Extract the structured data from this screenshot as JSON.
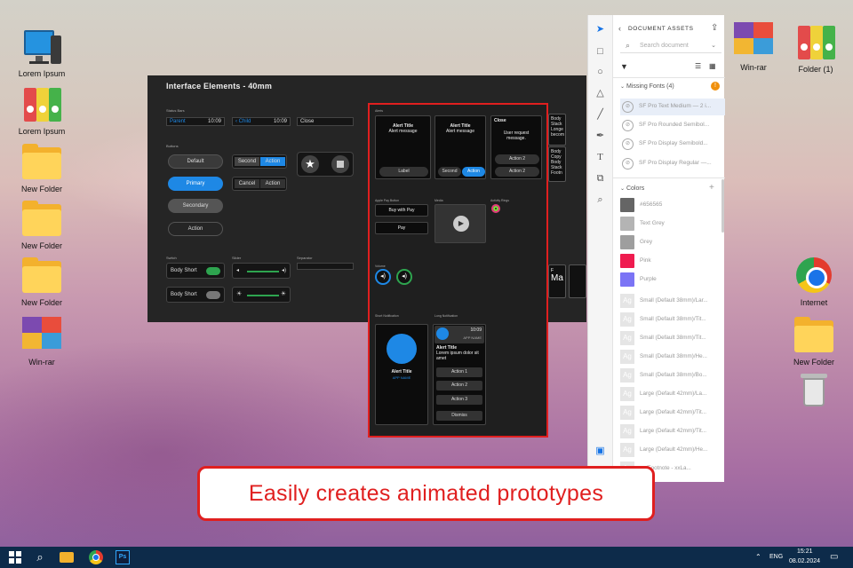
{
  "desktop_left": [
    {
      "label": "Lorem Ipsum",
      "icon": "computer-icon"
    },
    {
      "label": "Lorem Ipsum",
      "icon": "binders-icon"
    },
    {
      "label": "New Folder",
      "icon": "folder-icon"
    },
    {
      "label": "New Folder",
      "icon": "folder-icon"
    },
    {
      "label": "New Folder",
      "icon": "folder-icon"
    },
    {
      "label": "Win-rar",
      "icon": "winrar-icon"
    }
  ],
  "desktop_right": [
    {
      "label": "Win-rar",
      "icon": "winrar-icon"
    },
    {
      "label": "Folder (1)",
      "icon": "binders-icon"
    },
    {
      "label": "Internet",
      "icon": "chrome-icon"
    },
    {
      "label": "New Folder",
      "icon": "folder-icon"
    },
    {
      "label": "",
      "icon": "recycle-bin-icon"
    }
  ],
  "app": {
    "title": "Interface Elements - 40mm",
    "status_bars_label": "Status Bars",
    "status_bars": [
      {
        "name": "Parent",
        "time": "10:09"
      },
      {
        "name": "Child",
        "time": "10:09"
      },
      {
        "name": "Close",
        "time": ""
      }
    ],
    "buttons_label": "Buttons",
    "buttons": [
      "Default",
      "Primary",
      "Secondary",
      "Action"
    ],
    "segmented": [
      [
        "Second",
        "Action"
      ],
      [
        "Cancel",
        "Action"
      ]
    ],
    "switch_label": "Switch",
    "slider_label": "Slider",
    "separator_label": "Separator",
    "switches": [
      "Body Short",
      "Body Short"
    ],
    "partial_texts": [
      "ger",
      "Body",
      "Stack",
      "Longe",
      "becom",
      "Body",
      "Copy",
      "Body",
      "Stack",
      "Footn"
    ]
  },
  "artboard": {
    "alerts_label": "Alerts",
    "alert1": {
      "title": "Alert Title",
      "message": "Alert message",
      "button": "Label"
    },
    "alert2": {
      "title": "Alert Title",
      "message": "Alert message",
      "buttons": [
        "Second",
        "Action"
      ]
    },
    "alert3": {
      "title": "Close",
      "message": "User request message.",
      "buttons": [
        "Action 2",
        "Action 2"
      ]
    },
    "apple_pay_label": "Apple Pay Button",
    "apple_pay": [
      "Buy with  Pay",
      " Pay"
    ],
    "media_label": "Media",
    "activity_label": "Activity Rings",
    "volume_label": "Volume",
    "short_notif_label": "Short Notification",
    "long_notif_label": "Long Notification",
    "short_notif": {
      "title": "Alert Title",
      "app": "APP NAME"
    },
    "long_notif": {
      "time": "10:09",
      "app": "APP NAME",
      "title": "Alert Title",
      "body": "Lorem ipsum dolor sit amet",
      "actions": [
        "Action 1",
        "Action 2",
        "Action 3",
        "Dismiss"
      ]
    }
  },
  "panel": {
    "title": "DOCUMENT ASSETS",
    "search_placeholder": "Search document",
    "missing_fonts_header": "Missing Fonts (4)",
    "fonts": [
      "SF Pro Text Medium — 2 i...",
      "SF Pro Rounded Semibol...",
      "SF Pro Display Semibold...",
      "SF Pro Display Regular —..."
    ],
    "colors_header": "Colors",
    "colors": [
      {
        "name": "#656565",
        "hex": "#656565"
      },
      {
        "name": "Text Grey",
        "hex": "#b4b4b4"
      },
      {
        "name": "Grey",
        "hex": "#9e9e9e"
      },
      {
        "name": "Pink",
        "hex": "#ef1b4f"
      },
      {
        "name": "Purple",
        "hex": "#7b74f5"
      }
    ],
    "char_styles": [
      "Small (Default 38mm)/Lar...",
      "Small (Default 38mm)/Tit...",
      "Small (Default 38mm)/Tit...",
      "Small (Default 38mm)/He...",
      "Small (Default 38mm)/Bo...",
      "Large (Default 42mm)/La...",
      "Large (Default 42mm)/Tit...",
      "Large (Default 42mm)/Tit...",
      "Large (Default 42mm)/He...",
      "ge/Footnote - xxLa..."
    ],
    "ag_glyph": "Ag"
  },
  "caption": "Easily creates animated prototypes",
  "taskbar": {
    "lang": "ENG",
    "time": "15:21",
    "date": "08.02.2024"
  },
  "watch_partial": [
    "F",
    "Ma",
    "2"
  ]
}
